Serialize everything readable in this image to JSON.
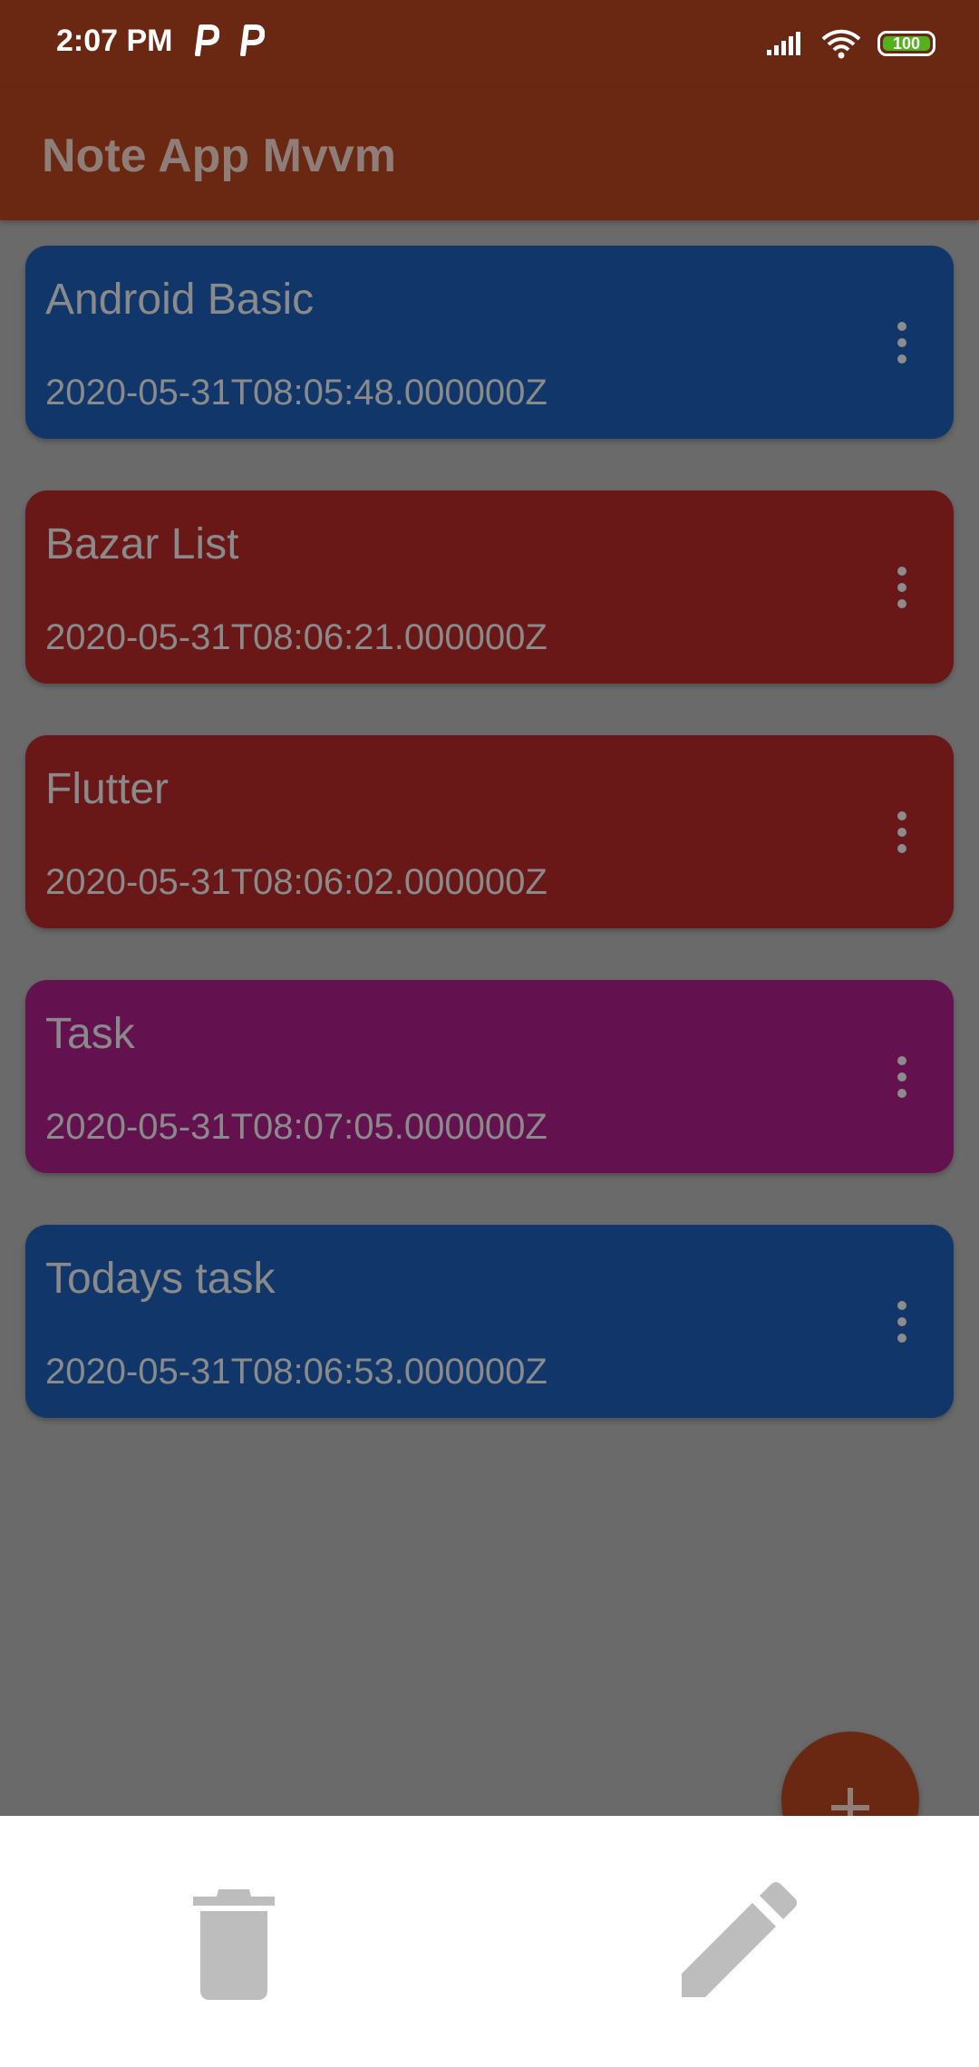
{
  "status_bar": {
    "time": "2:07 PM",
    "notification_icons": [
      "parking-p-icon",
      "parking-p-icon"
    ],
    "battery_level": "100",
    "icons": [
      "signal-icon",
      "wifi-icon",
      "battery-icon"
    ]
  },
  "app_bar": {
    "title": "Note App Mvvm"
  },
  "notes": [
    {
      "title": "Android Basic",
      "date": "2020-05-31T08:05:48.000000Z",
      "color": "#10366a"
    },
    {
      "title": "Bazar List",
      "date": "2020-05-31T08:06:21.000000Z",
      "color": "#6a1717"
    },
    {
      "title": "Flutter",
      "date": "2020-05-31T08:06:02.000000Z",
      "color": "#6a1717"
    },
    {
      "title": "Task",
      "date": "2020-05-31T08:07:05.000000Z",
      "color": "#63124f"
    },
    {
      "title": "Todays task",
      "date": "2020-05-31T08:06:53.000000Z",
      "color": "#10366a"
    }
  ],
  "fab": {
    "icon": "plus-icon"
  },
  "bottom_sheet": {
    "actions": [
      {
        "icon": "trash-icon"
      },
      {
        "icon": "edit-pencil-icon"
      }
    ]
  },
  "colors": {
    "primary_dark": "#6a2712",
    "scrim_background": "#6a6a6a",
    "sheet_icon": "#bdbdbd"
  }
}
